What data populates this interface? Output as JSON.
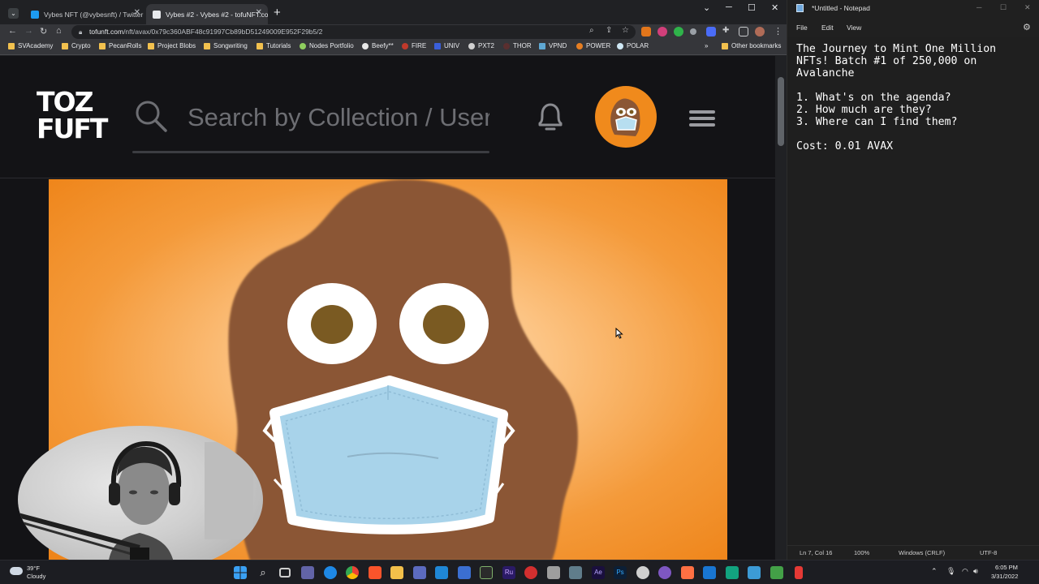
{
  "browser": {
    "tabs": [
      {
        "title": "Vybes NFT (@vybesnft) / Twitter",
        "active": false
      },
      {
        "title": "Vybes #2 - Vybes #2 - tofuNFT.co",
        "active": true
      }
    ],
    "new_tab_label": "+",
    "url_host": "tofunft.com",
    "url_path": "/nft/avax/0x79c360ABF48c91997Cb89bD51249009E952F29b5/2",
    "bookmarks": [
      "SVAcademy",
      "Crypto",
      "PecanRolls",
      "Project Blobs",
      "Songwriting",
      "Tutorials",
      "Nodes Portfolio",
      "Beefy**",
      "FIRE",
      "UNIV",
      "PXT2",
      "THOR",
      "VPND",
      "POWER",
      "POLAR"
    ],
    "other_bookmarks": "Other bookmarks",
    "more_bookmarks": "»"
  },
  "site": {
    "logo_line1": "TOZ",
    "logo_line2": "FUFT",
    "search_placeholder": "Search by Collection / User"
  },
  "notepad": {
    "title": "*Untitled - Notepad",
    "menu": [
      "File",
      "Edit",
      "View"
    ],
    "content": "The Journey to Mint One Million\nNFTs! Batch #1 of 250,000 on\nAvalanche\n\n1. What's on the agenda?\n2. How much are they?\n3. Where can I find them?\n\nCost: 0.01 AVAX",
    "status": {
      "position": "Ln 7, Col 16",
      "zoom": "100%",
      "line_ending": "Windows (CRLF)",
      "encoding": "UTF-8"
    }
  },
  "taskbar": {
    "temperature": "39°F",
    "condition": "Cloudy",
    "time": "6:05 PM",
    "date": "3/31/2022"
  },
  "colors": {
    "nft_background": "#f49a3a",
    "blob_brown": "#8b5634",
    "mask_blue": "#a8d3ea",
    "avatar_orange": "#f08a1c"
  }
}
